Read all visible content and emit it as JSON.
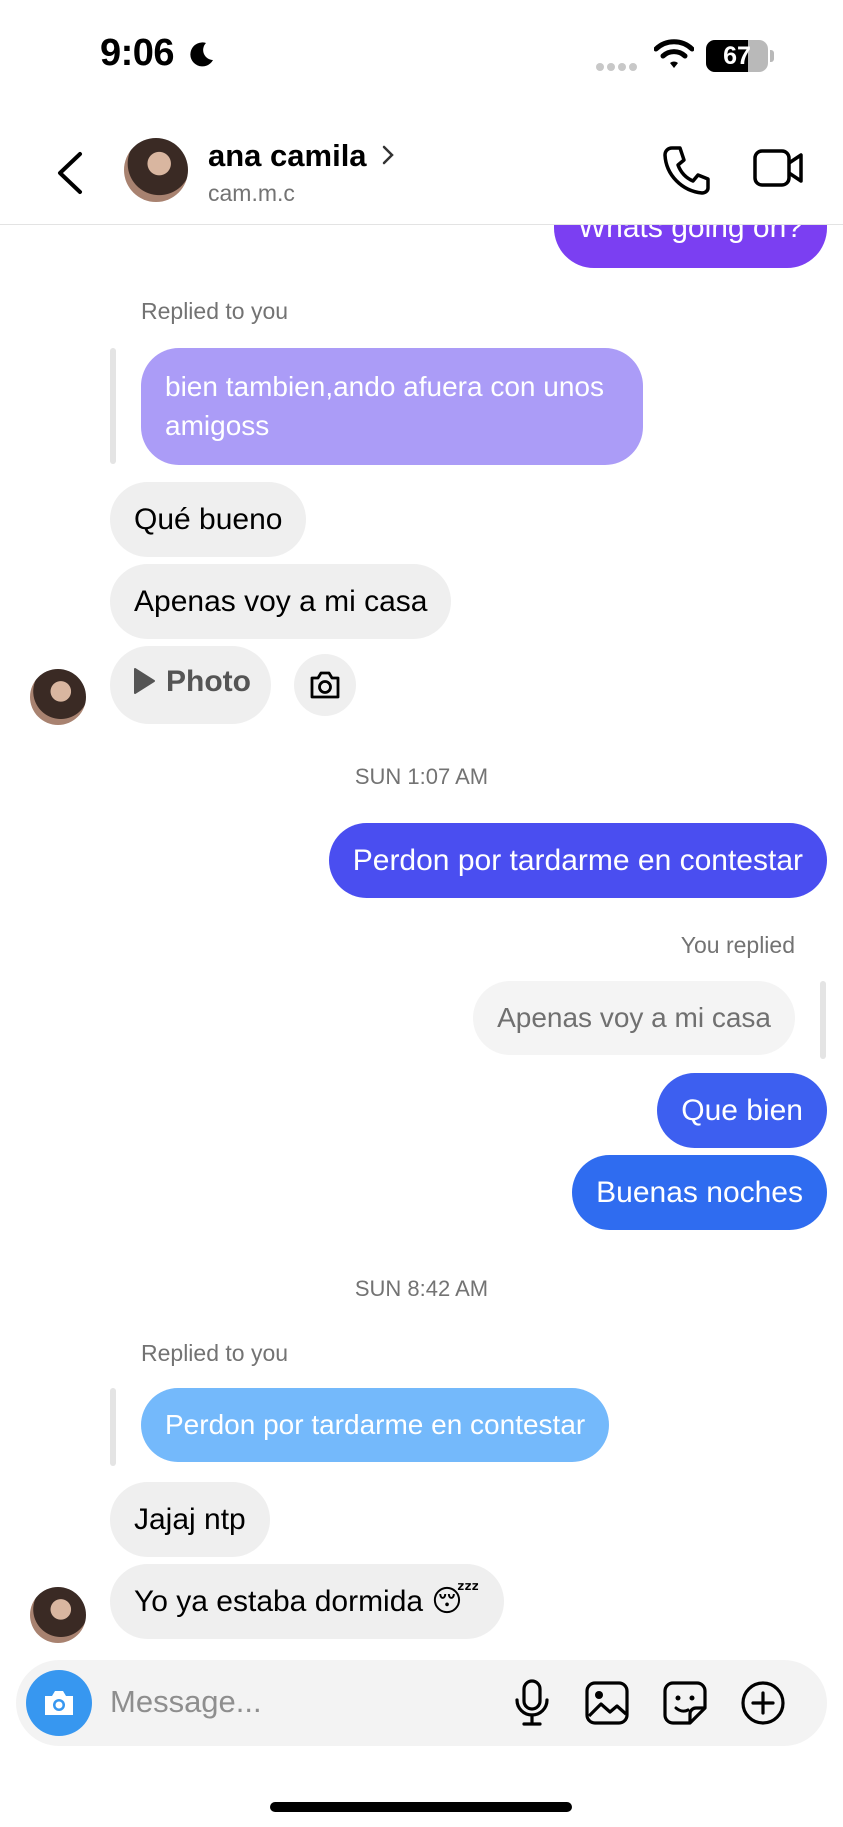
{
  "status_bar": {
    "time": "9:06",
    "battery": "67"
  },
  "header": {
    "name": "ana camila",
    "username": "cam.m.c"
  },
  "messages": {
    "partial_out": "Whats going on?",
    "reply_label_1": "Replied to you",
    "quoted_1": "bien tambien,ando afuera con unos amigoss",
    "in_1": "Qué bueno",
    "in_2": "Apenas voy a mi casa",
    "photo_label": "Photo",
    "timestamp_1": "SUN 1:07 AM",
    "out_1": "Perdon por tardarme en contestar",
    "you_replied_label": "You replied",
    "quoted_2": "Apenas voy a mi casa",
    "out_2": "Que bien",
    "out_3": "Buenas noches",
    "timestamp_2": "SUN 8:42 AM",
    "reply_label_2": "Replied to you",
    "quoted_3": "Perdon por tardarme en contestar",
    "in_3": "Jajaj ntp",
    "in_4": "Yo ya estaba dormida 😴"
  },
  "composer": {
    "placeholder": "Message..."
  },
  "colors": {
    "purple": "#7b3ff2",
    "light_purple": "#ab9cf7",
    "indigo": "#4a4ef0",
    "blue": "#2f6cf0",
    "light_blue": "#74b9fb",
    "accent_blue": "#3797f0"
  },
  "icons": [
    "moon-icon",
    "wifi-icon",
    "back-icon",
    "chevron-right-icon",
    "phone-icon",
    "video-icon",
    "play-icon",
    "camera-icon",
    "mic-icon",
    "gallery-icon",
    "sticker-icon",
    "plus-icon"
  ]
}
